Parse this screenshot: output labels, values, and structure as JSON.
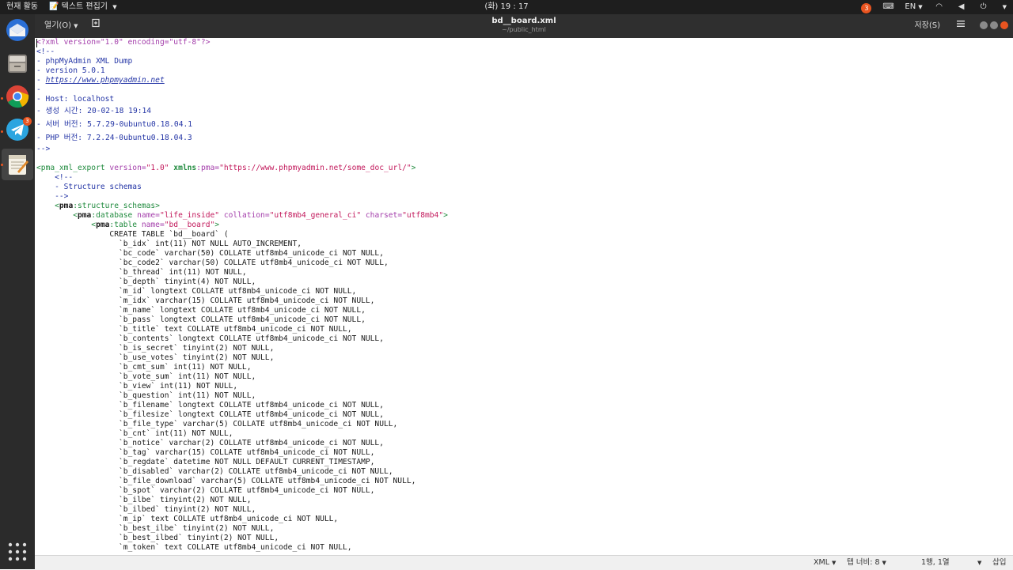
{
  "topbar": {
    "activities": "현재 활동",
    "app_menu": "텍스트 편집기",
    "clock": "(화) 19 : 17",
    "notif_count": "3",
    "lang": "EN"
  },
  "dock": {
    "telegram_badge": "3"
  },
  "header": {
    "open_label": "열기(O)",
    "title": "bd__board.xml",
    "subtitle": "~/public_html",
    "save_label": "저장(S)"
  },
  "editor": {
    "lines": [
      [
        {
          "c": "c-pi",
          "t": "<?xml version=\"1.0\" encoding=\"utf-8\"?>"
        }
      ],
      [
        {
          "c": "c-cm",
          "t": "<!--"
        }
      ],
      [
        {
          "c": "c-cm",
          "t": "- phpMyAdmin XML Dump"
        }
      ],
      [
        {
          "c": "c-cm",
          "t": "- version 5.0.1"
        }
      ],
      [
        {
          "c": "c-cm",
          "t": "- "
        },
        {
          "c": "c-link",
          "t": "https://www.phpmyadmin.net"
        }
      ],
      [
        {
          "c": "c-cm",
          "t": "-"
        }
      ],
      [
        {
          "c": "c-cm",
          "t": "- Host: localhost"
        }
      ],
      [
        {
          "c": "c-cm",
          "t": "- 생성 시간: 20-02-18 19:14",
          "tall": true
        }
      ],
      [
        {
          "c": "c-cm",
          "t": "- 서버 버전: 5.7.29-0ubuntu0.18.04.1",
          "tall": true
        }
      ],
      [
        {
          "c": "c-cm",
          "t": "- PHP 버전: 7.2.24-0ubuntu0.18.04.3",
          "tall": true
        }
      ],
      [
        {
          "c": "c-cm",
          "t": "-->"
        }
      ],
      [
        {
          "c": "",
          "t": ""
        }
      ],
      [
        {
          "c": "c-tag",
          "t": "<pma_xml_export "
        },
        {
          "c": "c-attr",
          "t": "version="
        },
        {
          "c": "c-str",
          "t": "\"1.0\" "
        },
        {
          "c": "c-xmlns",
          "t": "xmlns"
        },
        {
          "c": "c-attr",
          "t": ":pma="
        },
        {
          "c": "c-str",
          "t": "\"https://www.phpmyadmin.net/some_doc_url/\""
        },
        {
          "c": "c-tag",
          "t": ">"
        }
      ],
      [
        {
          "c": "c-cm",
          "t": "    <!--"
        }
      ],
      [
        {
          "c": "c-cm",
          "t": "    - Structure schemas"
        }
      ],
      [
        {
          "c": "c-cm",
          "t": "    -->"
        }
      ],
      [
        {
          "c": "c-tag",
          "t": "    <"
        },
        {
          "c": "c-ns",
          "t": "pma"
        },
        {
          "c": "c-tag",
          "t": ":structure_schemas>"
        }
      ],
      [
        {
          "c": "c-tag",
          "t": "        <"
        },
        {
          "c": "c-ns",
          "t": "pma"
        },
        {
          "c": "c-tag",
          "t": ":database "
        },
        {
          "c": "c-attr",
          "t": "name="
        },
        {
          "c": "c-str",
          "t": "\"life_inside\" "
        },
        {
          "c": "c-attr",
          "t": "collation="
        },
        {
          "c": "c-str",
          "t": "\"utf8mb4_general_ci\" "
        },
        {
          "c": "c-attr",
          "t": "charset="
        },
        {
          "c": "c-str",
          "t": "\"utf8mb4\""
        },
        {
          "c": "c-tag",
          "t": ">"
        }
      ],
      [
        {
          "c": "c-tag",
          "t": "            <"
        },
        {
          "c": "c-ns",
          "t": "pma"
        },
        {
          "c": "c-tag",
          "t": ":table "
        },
        {
          "c": "c-attr",
          "t": "name="
        },
        {
          "c": "c-str",
          "t": "\"bd__board\""
        },
        {
          "c": "c-tag",
          "t": ">"
        }
      ],
      [
        {
          "c": "",
          "t": "                CREATE TABLE `bd__board` ("
        }
      ],
      [
        {
          "c": "",
          "t": "                  `b_idx` int(11) NOT NULL AUTO_INCREMENT,"
        }
      ],
      [
        {
          "c": "",
          "t": "                  `bc_code` varchar(50) COLLATE utf8mb4_unicode_ci NOT NULL,"
        }
      ],
      [
        {
          "c": "",
          "t": "                  `bc_code2` varchar(50) COLLATE utf8mb4_unicode_ci NOT NULL,"
        }
      ],
      [
        {
          "c": "",
          "t": "                  `b_thread` int(11) NOT NULL,"
        }
      ],
      [
        {
          "c": "",
          "t": "                  `b_depth` tinyint(4) NOT NULL,"
        }
      ],
      [
        {
          "c": "",
          "t": "                  `m_id` longtext COLLATE utf8mb4_unicode_ci NOT NULL,"
        }
      ],
      [
        {
          "c": "",
          "t": "                  `m_idx` varchar(15) COLLATE utf8mb4_unicode_ci NOT NULL,"
        }
      ],
      [
        {
          "c": "",
          "t": "                  `m_name` longtext COLLATE utf8mb4_unicode_ci NOT NULL,"
        }
      ],
      [
        {
          "c": "",
          "t": "                  `b_pass` longtext COLLATE utf8mb4_unicode_ci NOT NULL,"
        }
      ],
      [
        {
          "c": "",
          "t": "                  `b_title` text COLLATE utf8mb4_unicode_ci NOT NULL,"
        }
      ],
      [
        {
          "c": "",
          "t": "                  `b_contents` longtext COLLATE utf8mb4_unicode_ci NOT NULL,"
        }
      ],
      [
        {
          "c": "",
          "t": "                  `b_is_secret` tinyint(2) NOT NULL,"
        }
      ],
      [
        {
          "c": "",
          "t": "                  `b_use_votes` tinyint(2) NOT NULL,"
        }
      ],
      [
        {
          "c": "",
          "t": "                  `b_cmt_sum` int(11) NOT NULL,"
        }
      ],
      [
        {
          "c": "",
          "t": "                  `b_vote_sum` int(11) NOT NULL,"
        }
      ],
      [
        {
          "c": "",
          "t": "                  `b_view` int(11) NOT NULL,"
        }
      ],
      [
        {
          "c": "",
          "t": "                  `b_question` int(11) NOT NULL,"
        }
      ],
      [
        {
          "c": "",
          "t": "                  `b_filename` longtext COLLATE utf8mb4_unicode_ci NOT NULL,"
        }
      ],
      [
        {
          "c": "",
          "t": "                  `b_filesize` longtext COLLATE utf8mb4_unicode_ci NOT NULL,"
        }
      ],
      [
        {
          "c": "",
          "t": "                  `b_file_type` varchar(5) COLLATE utf8mb4_unicode_ci NOT NULL,"
        }
      ],
      [
        {
          "c": "",
          "t": "                  `b_cnt` int(11) NOT NULL,"
        }
      ],
      [
        {
          "c": "",
          "t": "                  `b_notice` varchar(2) COLLATE utf8mb4_unicode_ci NOT NULL,"
        }
      ],
      [
        {
          "c": "",
          "t": "                  `b_tag` varchar(15) COLLATE utf8mb4_unicode_ci NOT NULL,"
        }
      ],
      [
        {
          "c": "",
          "t": "                  `b_regdate` datetime NOT NULL DEFAULT CURRENT_TIMESTAMP,"
        }
      ],
      [
        {
          "c": "",
          "t": "                  `b_disabled` varchar(2) COLLATE utf8mb4_unicode_ci NOT NULL,"
        }
      ],
      [
        {
          "c": "",
          "t": "                  `b_file_download` varchar(5) COLLATE utf8mb4_unicode_ci NOT NULL,"
        }
      ],
      [
        {
          "c": "",
          "t": "                  `b_spot` varchar(2) COLLATE utf8mb4_unicode_ci NOT NULL,"
        }
      ],
      [
        {
          "c": "",
          "t": "                  `b_ilbe` tinyint(2) NOT NULL,"
        }
      ],
      [
        {
          "c": "",
          "t": "                  `b_ilbed` tinyint(2) NOT NULL,"
        }
      ],
      [
        {
          "c": "",
          "t": "                  `m_ip` text COLLATE utf8mb4_unicode_ci NOT NULL,"
        }
      ],
      [
        {
          "c": "",
          "t": "                  `b_best_ilbe` tinyint(2) NOT NULL,"
        }
      ],
      [
        {
          "c": "",
          "t": "                  `b_best_ilbed` tinyint(2) NOT NULL,"
        }
      ],
      [
        {
          "c": "",
          "t": "                  `m_token` text COLLATE utf8mb4_unicode_ci NOT NULL,"
        }
      ]
    ]
  },
  "statusbar": {
    "language": "XML",
    "tab_width": "탭 너비: 8",
    "position": "1행, 1열",
    "mode": "삽입"
  }
}
